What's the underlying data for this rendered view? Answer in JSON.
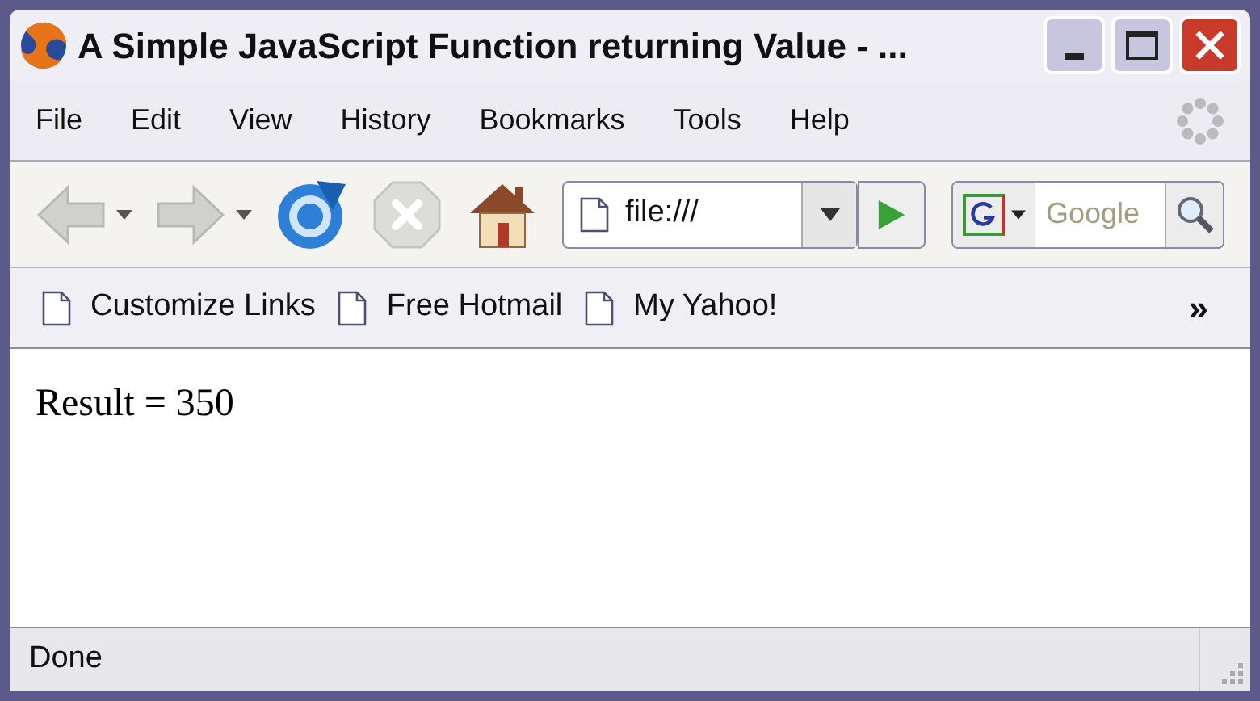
{
  "window": {
    "title": "A Simple JavaScript Function returning Value - ..."
  },
  "menu": [
    "File",
    "Edit",
    "View",
    "History",
    "Bookmarks",
    "Tools",
    "Help"
  ],
  "toolbar": {
    "buttons": [
      {
        "kind": "back",
        "disabled": true
      },
      {
        "kind": "forward",
        "disabled": true
      },
      {
        "kind": "reload",
        "disabled": false
      },
      {
        "kind": "stop",
        "disabled": true
      },
      {
        "kind": "home",
        "disabled": false
      }
    ],
    "address": {
      "value": "file:///"
    },
    "search": {
      "placeholder": "Google"
    }
  },
  "bookmarks": {
    "items": [
      "Customize Links",
      "Free Hotmail",
      "My Yahoo!"
    ],
    "overflow": "»"
  },
  "content": {
    "text": "Result = 350"
  },
  "status_bar": {
    "text": "Done"
  }
}
